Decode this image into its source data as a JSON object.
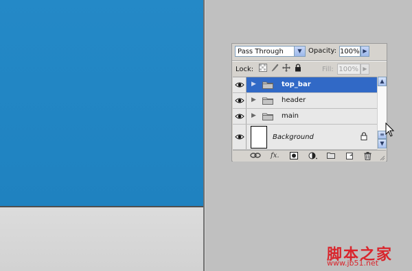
{
  "panel": {
    "blend_mode": "Pass Through",
    "opacity_label": "Opacity:",
    "opacity_value": "100%",
    "lock_label": "Lock:",
    "fill_label": "Fill:",
    "fill_value": "100%",
    "layers": [
      {
        "name": "top_bar",
        "type": "group",
        "selected": true
      },
      {
        "name": "header",
        "type": "group",
        "selected": false
      },
      {
        "name": "main",
        "type": "group",
        "selected": false
      },
      {
        "name": "Background",
        "type": "background",
        "selected": false
      }
    ],
    "bottom_icons": [
      "link-layers-icon",
      "fx-icon",
      "mask-icon",
      "adjustment-layer-icon",
      "new-group-icon",
      "new-layer-icon",
      "trash-icon"
    ]
  },
  "watermark": {
    "text": "脚本之家",
    "url": "www.jb51.net"
  },
  "colors": {
    "canvas_blue": "#2489c7",
    "selection": "#3169c6",
    "watermark": "#d9252c"
  }
}
